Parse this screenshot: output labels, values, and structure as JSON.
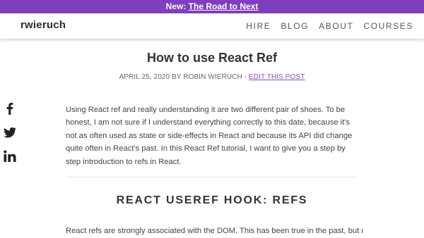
{
  "announcement": {
    "prefix": "New:",
    "link": "The Road to Next"
  },
  "header": {
    "logo": "rwieruch",
    "nav": [
      "HIRE",
      "BLOG",
      "ABOUT",
      "COURSES"
    ]
  },
  "article": {
    "title": "How to use React Ref",
    "meta_date_author": "APRIL 25, 2020 BY ROBIN WIERUCH",
    "meta_separator": " - ",
    "meta_edit": "EDIT THIS POST",
    "intro": "Using React ref and really understanding it are two different pair of shoes. To be honest, I am not sure if I understand everything correctly to this date, because it's not as often used as state or side-effects in React and because its API did change quite often in React's past. In this React Ref tutorial, I want to give you a step by step introduction to refs in React.",
    "section_heading": "REACT USEREF HOOK: REFS",
    "section_text": "React refs are strongly associated with the DOM. This has been true in the past, but not"
  },
  "social": [
    "facebook-icon",
    "twitter-icon",
    "linkedin-icon"
  ]
}
